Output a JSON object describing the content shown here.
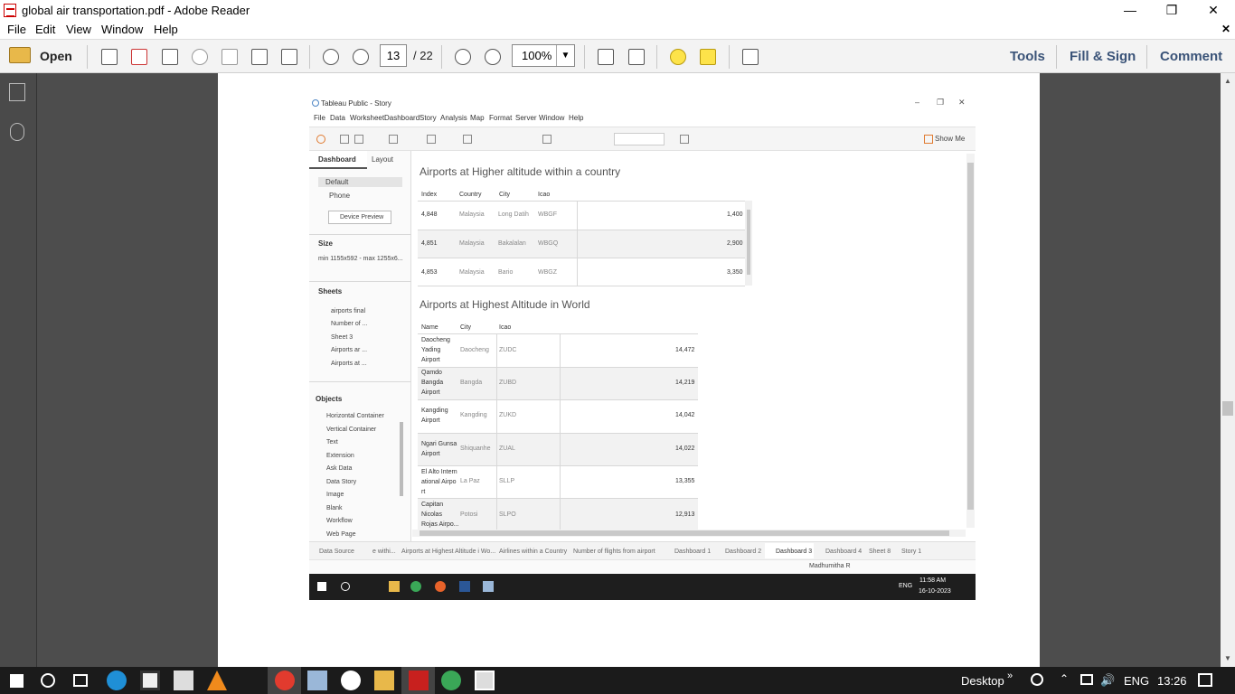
{
  "window": {
    "title": "global air transportation.pdf - Adobe Reader"
  },
  "menu": [
    "File",
    "Edit",
    "View",
    "Window",
    "Help"
  ],
  "toolbar": {
    "open_label": "Open",
    "page_current": "13",
    "page_total": "/ 22",
    "zoom": "100%",
    "tools": "Tools",
    "fill_sign": "Fill & Sign",
    "comment": "Comment"
  },
  "tableau": {
    "title": "Tableau Public - Story",
    "menu": [
      "File",
      "Data",
      "Worksheet",
      "Dashboard",
      "Story",
      "Analysis",
      "Map",
      "Format",
      "Server",
      "Window",
      "Help"
    ],
    "show_me": "Show Me",
    "sidebar": {
      "tab_dashboard": "Dashboard",
      "tab_layout": "Layout",
      "default": "Default",
      "phone": "Phone",
      "device_preview": "Device Preview",
      "size_header": "Size",
      "size_value": "min 1155x592 - max 1255x6...",
      "sheets_header": "Sheets",
      "sheets": [
        "airports final",
        "Number of ...",
        "Sheet 3",
        "Airports ar ...",
        "Airports at ..."
      ],
      "objects_header": "Objects",
      "objects": [
        "Horizontal Container",
        "Vertical Container",
        "Text",
        "Extension",
        "Ask Data",
        "Data Story",
        "Image",
        "Blank",
        "Workflow",
        "Web Page"
      ]
    },
    "table1": {
      "title": "Airports at Higher altitude within a country",
      "headers": [
        "Index",
        "Country",
        "City",
        "Icao"
      ],
      "rows": [
        {
          "index": "4,848",
          "country": "Malaysia",
          "city": "Long Datih",
          "icao": "WBGF",
          "value": "1,400"
        },
        {
          "index": "4,851",
          "country": "Malaysia",
          "city": "Bakalalan",
          "icao": "WBGQ",
          "value": "2,900"
        },
        {
          "index": "4,853",
          "country": "Malaysia",
          "city": "Bario",
          "icao": "WBGZ",
          "value": "3,350"
        }
      ]
    },
    "table2": {
      "title": "Airports at Highest Altitude in World",
      "headers": [
        "Name",
        "City",
        "Icao"
      ],
      "rows": [
        {
          "name": [
            "Daocheng",
            "Yading",
            "Airport"
          ],
          "city": "Daocheng",
          "icao": "ZUDC",
          "value": "14,472"
        },
        {
          "name": [
            "Qamdo",
            "Bangda",
            "Airport"
          ],
          "city": "Bangda",
          "icao": "ZUBD",
          "value": "14,219"
        },
        {
          "name": [
            "Kangding",
            "Airport"
          ],
          "city": "Kangding",
          "icao": "ZUKD",
          "value": "14,042"
        },
        {
          "name": [
            "Ngari Gunsa",
            "Airport"
          ],
          "city": "Shiquanhe",
          "icao": "ZUAL",
          "value": "14,022"
        },
        {
          "name": [
            "El Alto Intern",
            "ational Airpo",
            "rt"
          ],
          "city": "La Paz",
          "icao": "SLLP",
          "value": "13,355"
        },
        {
          "name": [
            "Capitan",
            "Nicolas",
            "Rojas Airpo..."
          ],
          "city": "Potosi",
          "icao": "SLPO",
          "value": "12,913"
        }
      ]
    },
    "bottom_tabs": [
      "Data Source",
      "e withi...",
      "Airports at Highest Altitude i Wo...",
      "Airlines within a Country",
      "Number of flights from airport",
      "Dashboard 1",
      "Dashboard 2",
      "Dashboard 3",
      "Dashboard 4",
      "Sheet 8",
      "Story 1"
    ],
    "user": "Madhumitha R",
    "inner_taskbar": {
      "lang": "ENG",
      "time": "11:58 AM",
      "date": "16-10-2023"
    }
  },
  "taskbar": {
    "desktop": "Desktop",
    "lang": "ENG",
    "time": "13:26"
  }
}
